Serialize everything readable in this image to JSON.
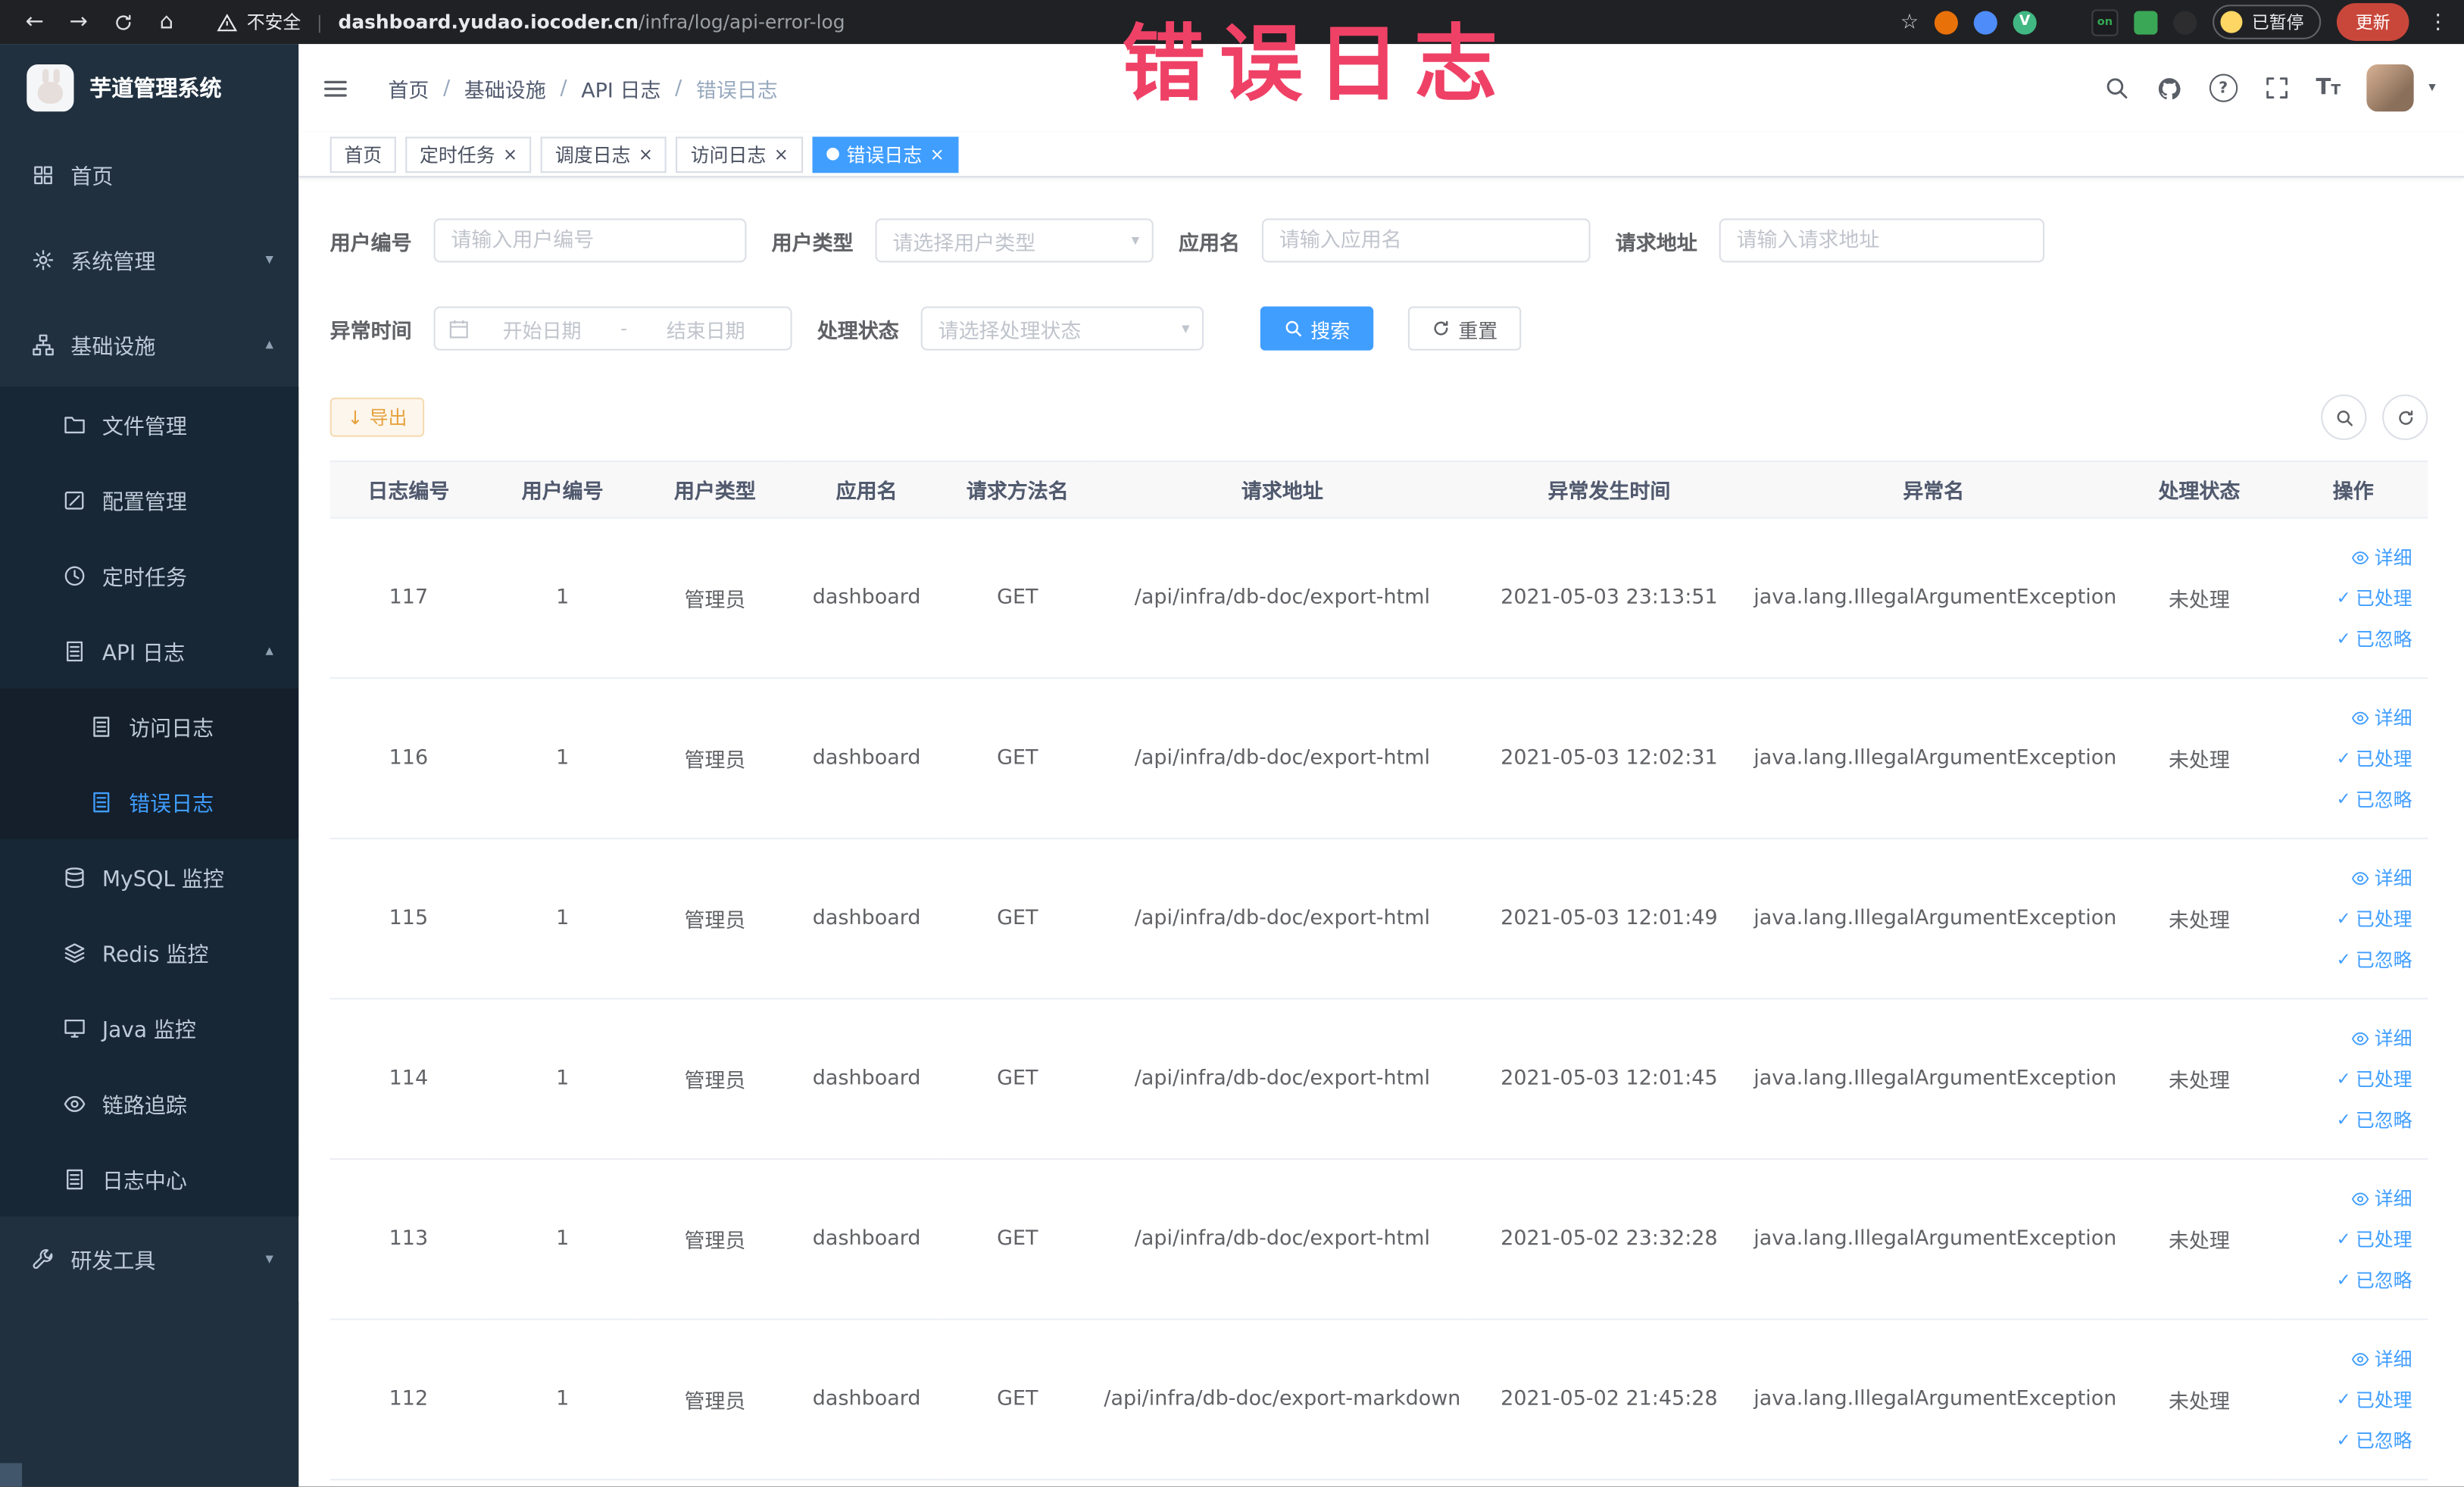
{
  "colors": {
    "accent": "#409eff",
    "annotation": "#ef4166",
    "warning": "#e6a23c",
    "sidebar_bg": "#20303f"
  },
  "browser": {
    "security_label": "不安全",
    "url_domain": "dashboard.yudao.iocoder.cn",
    "url_path": "/infra/log/api-error-log",
    "paused_badge": "已暂停",
    "update_button": "更新"
  },
  "annotation": {
    "text": "错误日志"
  },
  "icons": {
    "back": "←",
    "forward": "→",
    "home": "⌂",
    "star": "☆",
    "more_vertical": "⋮",
    "url_separator": "|",
    "breadcrumb_separator": "/",
    "chevron_down": "▾",
    "chevron_up": "▴",
    "caret_down": "▾",
    "close": "×",
    "active_dot": "●",
    "check": "✓",
    "select_arrow": "▾",
    "range_separator": "-",
    "download": "↓",
    "question": "?",
    "letter_T": "T",
    "vue_logo": "V",
    "on_badge": "on"
  },
  "sidebar": {
    "logo_title": "芋道管理系统",
    "items": [
      {
        "label": "首页"
      },
      {
        "label": "系统管理"
      },
      {
        "label": "基础设施"
      },
      {
        "label": "文件管理"
      },
      {
        "label": "配置管理"
      },
      {
        "label": "定时任务"
      },
      {
        "label": "API 日志"
      },
      {
        "label": "访问日志"
      },
      {
        "label": "错误日志"
      },
      {
        "label": "MySQL 监控"
      },
      {
        "label": "Redis 监控"
      },
      {
        "label": "Java 监控"
      },
      {
        "label": "链路追踪"
      },
      {
        "label": "日志中心"
      },
      {
        "label": "研发工具"
      }
    ]
  },
  "header": {
    "breadcrumb": [
      "首页",
      "基础设施",
      "API 日志",
      "错误日志"
    ]
  },
  "tabs": [
    {
      "label": "首页"
    },
    {
      "label": "定时任务"
    },
    {
      "label": "调度日志"
    },
    {
      "label": "访问日志"
    },
    {
      "label": "错误日志"
    }
  ],
  "filters": {
    "user_id": {
      "label": "用户编号",
      "placeholder": "请输入用户编号"
    },
    "user_type": {
      "label": "用户类型",
      "placeholder": "请选择用户类型"
    },
    "app_name": {
      "label": "应用名",
      "placeholder": "请输入应用名"
    },
    "request_url": {
      "label": "请求地址",
      "placeholder": "请输入请求地址"
    },
    "exception_time": {
      "label": "异常时间",
      "start_placeholder": "开始日期",
      "end_placeholder": "结束日期"
    },
    "process_status": {
      "label": "处理状态",
      "placeholder": "请选择处理状态"
    },
    "search_button": "搜索",
    "reset_button": "重置"
  },
  "toolbar": {
    "export_button": "导出"
  },
  "table": {
    "columns": [
      "日志编号",
      "用户编号",
      "用户类型",
      "应用名",
      "请求方法名",
      "请求地址",
      "异常发生时间",
      "异常名",
      "处理状态",
      "操作"
    ],
    "actions": [
      "详细",
      "已处理",
      "已忽略"
    ],
    "rows": [
      {
        "id": "117",
        "user_id": "1",
        "user_type": "管理员",
        "app": "dashboard",
        "method": "GET",
        "url": "/api/infra/db-doc/export-html",
        "time": "2021-05-03 23:13:51",
        "exception": "java.lang.IllegalArgumentException",
        "status": "未处理"
      },
      {
        "id": "116",
        "user_id": "1",
        "user_type": "管理员",
        "app": "dashboard",
        "method": "GET",
        "url": "/api/infra/db-doc/export-html",
        "time": "2021-05-03 12:02:31",
        "exception": "java.lang.IllegalArgumentException",
        "status": "未处理"
      },
      {
        "id": "115",
        "user_id": "1",
        "user_type": "管理员",
        "app": "dashboard",
        "method": "GET",
        "url": "/api/infra/db-doc/export-html",
        "time": "2021-05-03 12:01:49",
        "exception": "java.lang.IllegalArgumentException",
        "status": "未处理"
      },
      {
        "id": "114",
        "user_id": "1",
        "user_type": "管理员",
        "app": "dashboard",
        "method": "GET",
        "url": "/api/infra/db-doc/export-html",
        "time": "2021-05-03 12:01:45",
        "exception": "java.lang.IllegalArgumentException",
        "status": "未处理"
      },
      {
        "id": "113",
        "user_id": "1",
        "user_type": "管理员",
        "app": "dashboard",
        "method": "GET",
        "url": "/api/infra/db-doc/export-html",
        "time": "2021-05-02 23:32:28",
        "exception": "java.lang.IllegalArgumentException",
        "status": "未处理"
      },
      {
        "id": "112",
        "user_id": "1",
        "user_type": "管理员",
        "app": "dashboard",
        "method": "GET",
        "url": "/api/infra/db-doc/export-markdown",
        "time": "2021-05-02 21:45:28",
        "exception": "java.lang.IllegalArgumentException",
        "status": "未处理"
      }
    ]
  }
}
